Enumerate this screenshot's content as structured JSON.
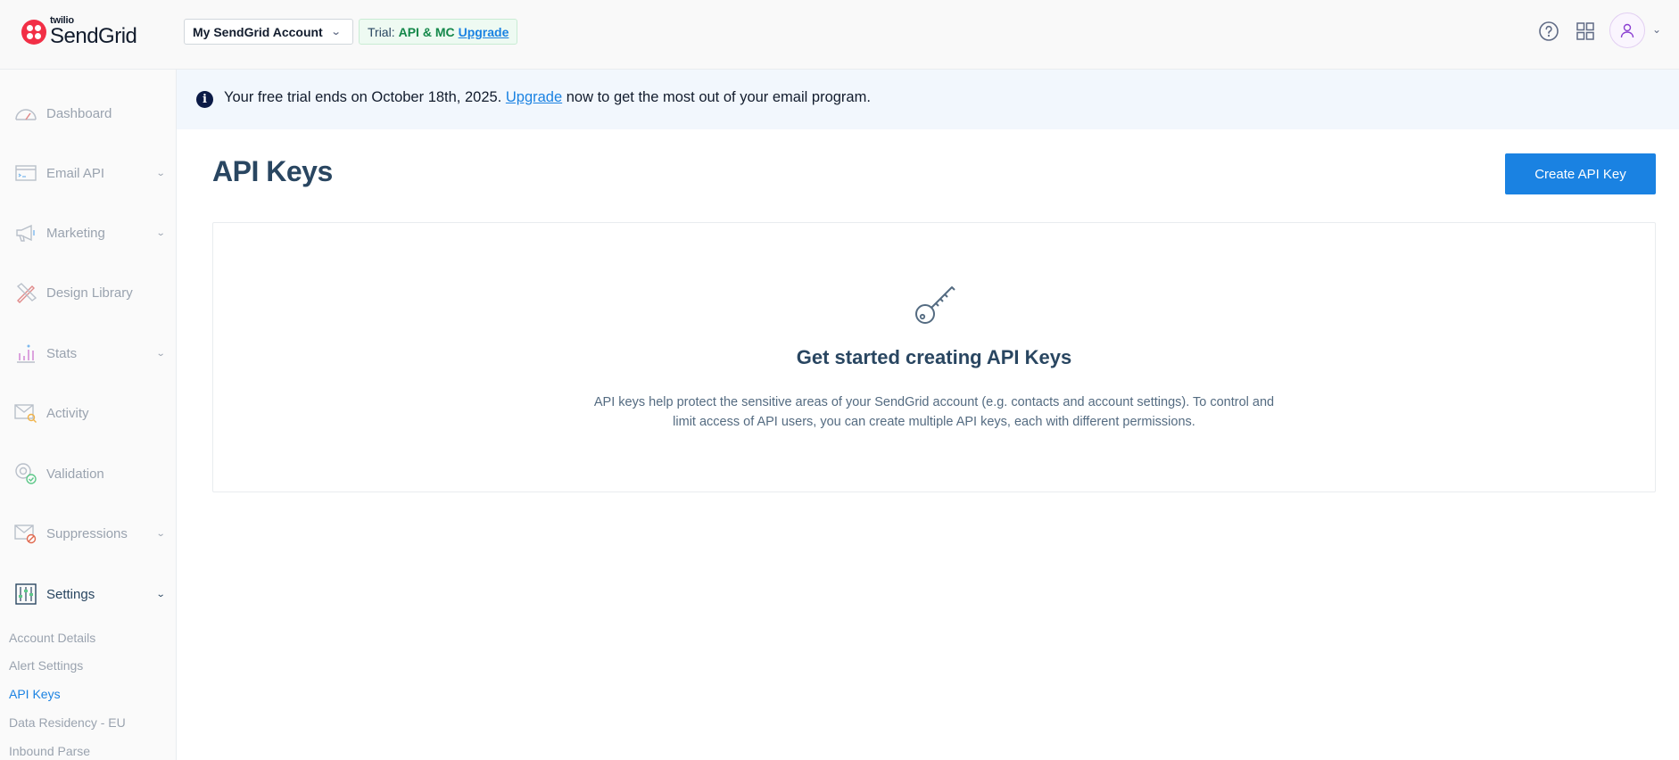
{
  "header": {
    "logo_small": "twilio",
    "logo_big": "SendGrid",
    "account_name": "My SendGrid Account",
    "trial_label": "Trial:",
    "trial_plan": "API & MC",
    "trial_upgrade": "Upgrade",
    "icons": [
      "help-icon",
      "app-grid-icon",
      "user-icon",
      "chevron-down-icon"
    ]
  },
  "sidebar": {
    "items": [
      {
        "label": "Dashboard",
        "icon": "gauge-icon",
        "has_chevron": false
      },
      {
        "label": "Email API",
        "icon": "terminal-card-icon",
        "has_chevron": true
      },
      {
        "label": "Marketing",
        "icon": "megaphone-icon",
        "has_chevron": true
      },
      {
        "label": "Design Library",
        "icon": "pencil-ruler-icon",
        "has_chevron": false
      },
      {
        "label": "Stats",
        "icon": "bar-chart-icon",
        "has_chevron": true
      },
      {
        "label": "Activity",
        "icon": "envelope-search-icon",
        "has_chevron": false
      },
      {
        "label": "Validation",
        "icon": "at-check-icon",
        "has_chevron": false
      },
      {
        "label": "Suppressions",
        "icon": "envelope-block-icon",
        "has_chevron": true
      },
      {
        "label": "Settings",
        "icon": "sliders-icon",
        "has_chevron": true
      }
    ],
    "settings_sub": [
      {
        "label": "Account Details"
      },
      {
        "label": "Alert Settings"
      },
      {
        "label": "API Keys"
      },
      {
        "label": "Data Residency - EU"
      },
      {
        "label": "Inbound Parse"
      }
    ]
  },
  "banner": {
    "text_before": "Your free trial ends on October 18th, 2025.",
    "link": "Upgrade",
    "text_after": "now to get the most out of your email program."
  },
  "main": {
    "title": "API Keys",
    "create_button": "Create API Key",
    "empty_title": "Get started creating API Keys",
    "empty_desc_line1": "API keys help protect the sensitive areas of your SendGrid account (e.g. contacts and account settings). To control and",
    "empty_desc_line2": "limit access of API users, you can create multiple API keys, each with different permissions."
  },
  "colors": {
    "brand_blue": "#1a82e2",
    "navy": "#294661",
    "twilio_red": "#f22f46",
    "trial_green": "#14884a"
  }
}
